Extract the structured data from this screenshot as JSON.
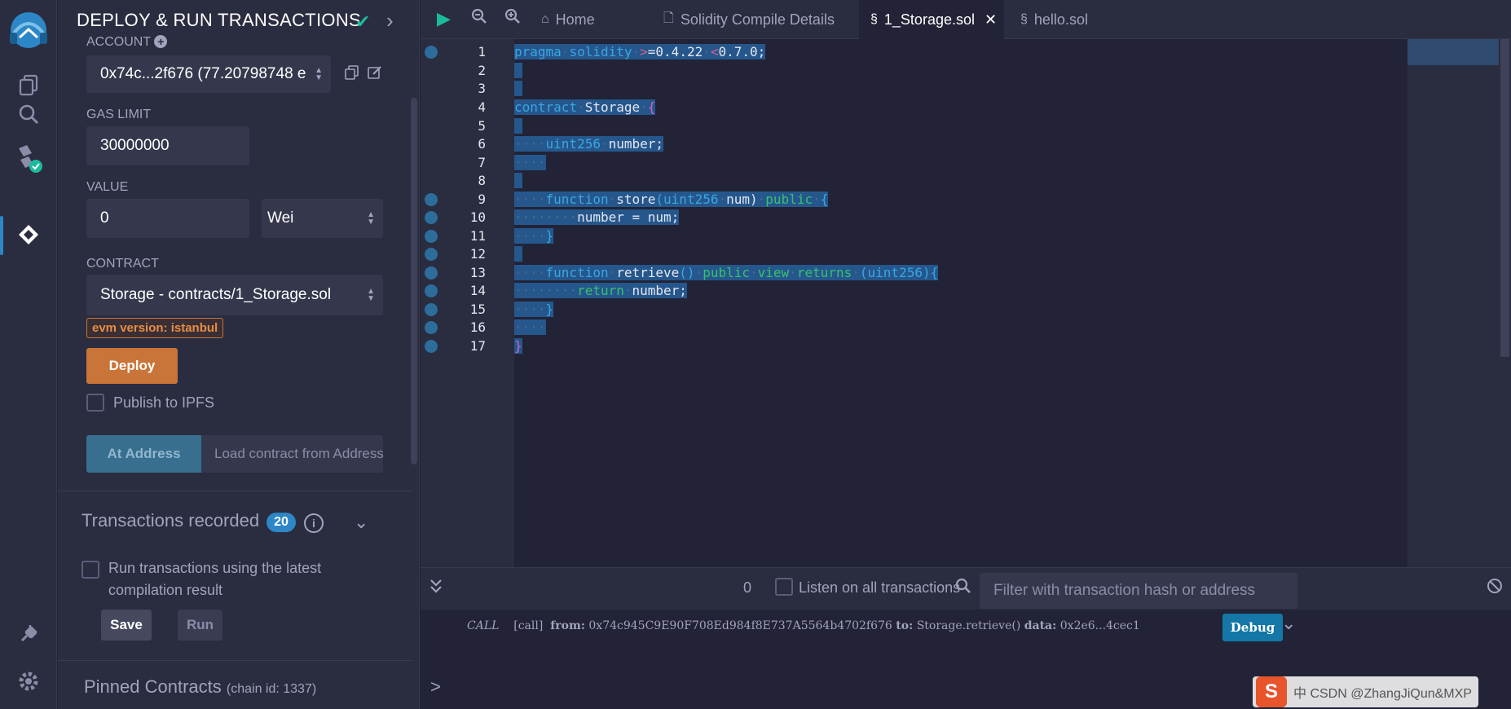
{
  "panel": {
    "title": "DEPLOY & RUN TRANSACTIONS",
    "account_label": "ACCOUNT",
    "account_value": "0x74c...2f676 (77.20798748 e",
    "gas_label": "GAS LIMIT",
    "gas_value": "30000000",
    "value_label": "VALUE",
    "value_amount": "0",
    "value_unit": "Wei",
    "contract_label": "CONTRACT",
    "contract_value": "Storage - contracts/1_Storage.sol",
    "evm_badge": "evm version: istanbul",
    "deploy_label": "Deploy",
    "publish_label": "Publish to IPFS",
    "at_address_label": "At Address",
    "load_placeholder": "Load contract from Address",
    "tx_recorded_label": "Transactions recorded",
    "tx_count": "20",
    "run_latest_label_1": "Run transactions using the latest",
    "run_latest_label_2": "compilation result",
    "save_label": "Save",
    "run_label": "Run",
    "pinned_label": "Pinned Contracts",
    "pinned_chain": "(chain id: 1337)"
  },
  "tabs": [
    {
      "label": "Home",
      "icon": "home-icon"
    },
    {
      "label": "Solidity Compile Details",
      "icon": "file-icon"
    },
    {
      "label": "1_Storage.sol",
      "icon": "solidity-icon",
      "active": true
    },
    {
      "label": "hello.sol",
      "icon": "solidity-icon"
    }
  ],
  "code_lines": [
    {
      "n": "1",
      "dot": true
    },
    {
      "n": "2"
    },
    {
      "n": "3"
    },
    {
      "n": "4"
    },
    {
      "n": "5"
    },
    {
      "n": "6"
    },
    {
      "n": "7"
    },
    {
      "n": "8"
    },
    {
      "n": "9",
      "dot": true
    },
    {
      "n": "10",
      "dot": true
    },
    {
      "n": "11",
      "dot": true
    },
    {
      "n": "12",
      "dot": true
    },
    {
      "n": "13",
      "dot": true
    },
    {
      "n": "14",
      "dot": true
    },
    {
      "n": "15",
      "dot": true
    },
    {
      "n": "16",
      "dot": true
    },
    {
      "n": "17",
      "dot": true
    }
  ],
  "code_text": {
    "l1_a": "pragma",
    "l1_b": "solidity",
    "l1_c": ">",
    "l1_d": "=0.4.22",
    "l1_e": "<",
    "l1_f": "0.7.0;",
    "l4_a": "contract",
    "l4_b": "Storage",
    "l4_c": "{",
    "l6_a": "uint256",
    "l6_b": "number;",
    "l9_a": "function",
    "l9_b": "store",
    "l9_c": "(uint256",
    "l9_d": "num)",
    "l9_e": "public",
    "l9_f": "{",
    "l10_a": "number = num;",
    "l11_a": "}",
    "l13_a": "function",
    "l13_b": "retrieve",
    "l13_c": "()",
    "l13_d": "public",
    "l13_e": "view",
    "l13_f": "returns",
    "l13_g": "(uint256){",
    "l14_a": "return",
    "l14_b": "number;",
    "l15_a": "}",
    "l17_a": "}"
  },
  "terminal": {
    "count": "0",
    "listen_label": "Listen on all transactions",
    "filter_placeholder": "Filter with transaction hash or address",
    "log_type": "CALL",
    "log_tag": "[call]",
    "log_from_label": "from:",
    "log_from": "0x74c945C9E90F708Ed984f8E737A5564b4702f676",
    "log_to_label": "to:",
    "log_to": "Storage.retrieve()",
    "log_data_label": "data:",
    "log_data": "0x2e6...4cec1",
    "debug_label": "Debug",
    "prompt": ">"
  },
  "watermark": {
    "logo": "S",
    "text": "中 CSDN @ZhangJiQun&MXP"
  },
  "colors": {
    "accent": "#2d87c6",
    "deploy": "#c97539",
    "success": "#1bbc9b"
  }
}
